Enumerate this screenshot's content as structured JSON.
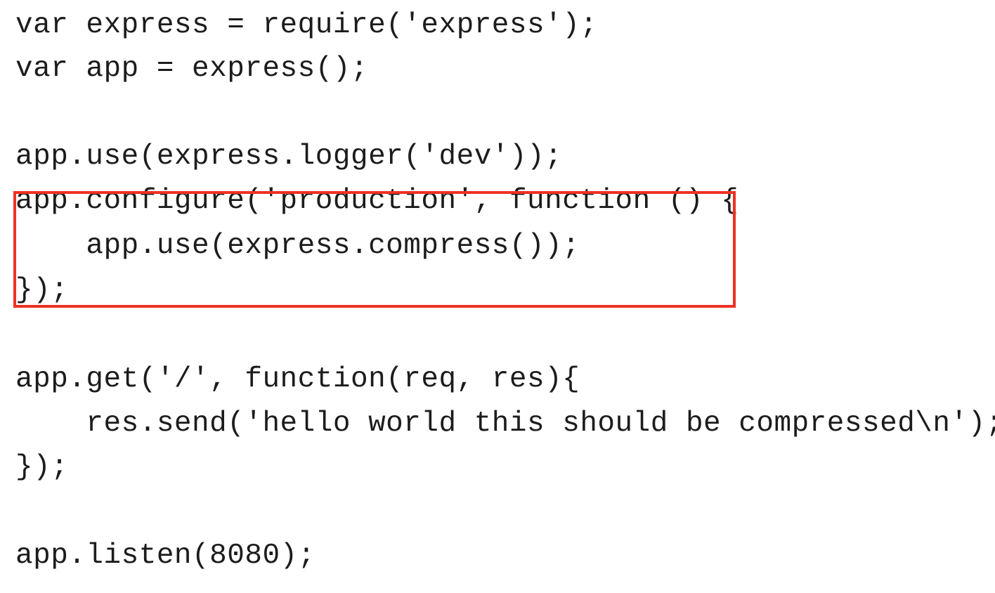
{
  "code_lines": [
    "var express = require('express');",
    "var app = express();",
    "app.use(express.logger('dev'));",
    "app.configure('production', function () {",
    "    app.use(express.compress());",
    "});",
    "app.get('/', function(req, res){",
    "    res.send('hello world this should be compressed\\n');",
    "});",
    "app.listen(8080);"
  ],
  "highlight": {
    "color": "#ee3124",
    "covers_lines": [
      4,
      5,
      6
    ]
  },
  "colors": {
    "background": "#ffffff",
    "text": "#1c1c1c"
  }
}
